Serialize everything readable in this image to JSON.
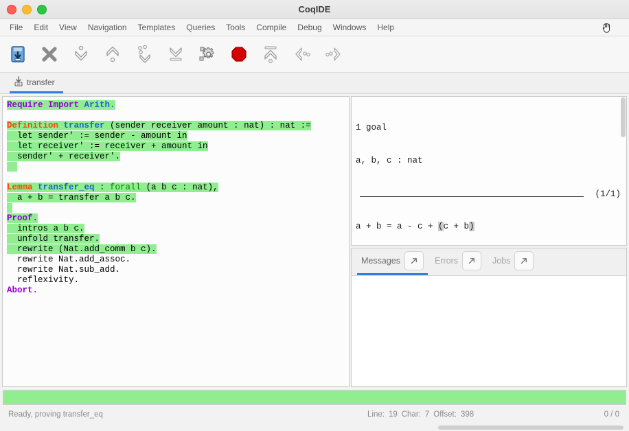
{
  "window": {
    "title": "CoqIDE",
    "controls": [
      "close",
      "minimize",
      "maximize"
    ]
  },
  "menubar": {
    "items": [
      "File",
      "Edit",
      "View",
      "Navigation",
      "Templates",
      "Queries",
      "Tools",
      "Compile",
      "Debug",
      "Windows",
      "Help"
    ],
    "cursor_icon": "open-hand-cursor-icon"
  },
  "toolbar": {
    "buttons": [
      {
        "name": "save-icon",
        "tooltip": "Save"
      },
      {
        "name": "close-x-icon",
        "tooltip": "Close"
      },
      {
        "name": "forward-one-step-icon",
        "tooltip": "Forward one step"
      },
      {
        "name": "backward-one-step-icon",
        "tooltip": "Backward one step"
      },
      {
        "name": "go-to-cursor-icon",
        "tooltip": "Go to cursor"
      },
      {
        "name": "go-to-end-icon",
        "tooltip": "Go to end"
      },
      {
        "name": "compile-gears-icon",
        "tooltip": "Compile"
      },
      {
        "name": "interrupt-stop-icon",
        "tooltip": "Interrupt"
      },
      {
        "name": "restart-icon",
        "tooltip": "Restart"
      },
      {
        "name": "previous-occurrence-icon",
        "tooltip": "Previous"
      },
      {
        "name": "next-occurrence-icon",
        "tooltip": "Next"
      }
    ]
  },
  "file_tabs": [
    {
      "label": "transfer",
      "icon": "file-save-icon",
      "active": true
    }
  ],
  "editor": {
    "lines": [
      {
        "segments": [
          {
            "text": "Require Import ",
            "style": "kw-purple",
            "hl": true
          },
          {
            "text": "Arith.",
            "style": "id-blue",
            "hl": true
          }
        ]
      },
      {
        "segments": []
      },
      {
        "segments": [
          {
            "text": "Definition ",
            "style": "kw-red",
            "hl": true
          },
          {
            "text": "transfer ",
            "style": "id-blue",
            "hl": true
          },
          {
            "text": "(sender receiver amount : nat) : nat :=",
            "style": "plain",
            "hl": true
          }
        ]
      },
      {
        "segments": [
          {
            "text": "  let sender' := sender - amount in",
            "style": "plain",
            "hl": true
          }
        ]
      },
      {
        "segments": [
          {
            "text": "  let receiver' := receiver + amount in",
            "style": "plain",
            "hl": true
          }
        ]
      },
      {
        "segments": [
          {
            "text": "  sender' + receiver'.",
            "style": "plain",
            "hl": true
          }
        ]
      },
      {
        "segments": [
          {
            "text": "  ",
            "style": "plain",
            "hl": true
          }
        ]
      },
      {
        "segments": []
      },
      {
        "segments": [
          {
            "text": "Lemma ",
            "style": "kw-red",
            "hl": true
          },
          {
            "text": "transfer_eq ",
            "style": "id-blue",
            "hl": true
          },
          {
            "text": ": ",
            "style": "plain",
            "hl": true
          },
          {
            "text": "forall ",
            "style": "ty-green",
            "hl": true
          },
          {
            "text": "(a b c : nat),",
            "style": "plain",
            "hl": true
          }
        ]
      },
      {
        "segments": [
          {
            "text": "  a + b = transfer a b c.",
            "style": "plain",
            "hl": true
          }
        ]
      },
      {
        "segments": [
          {
            "text": " ",
            "style": "plain",
            "hl": true
          }
        ]
      },
      {
        "segments": [
          {
            "text": "Proof.",
            "style": "kw-purple",
            "hl": true
          }
        ]
      },
      {
        "segments": [
          {
            "text": "  intros a b c.",
            "style": "plain",
            "hl": true
          }
        ]
      },
      {
        "segments": [
          {
            "text": "  unfold transfer.",
            "style": "plain",
            "hl": true
          }
        ]
      },
      {
        "segments": [
          {
            "text": "  rewrite (Nat.add_comm b c).",
            "style": "plain",
            "hl": true
          }
        ]
      },
      {
        "segments": [
          {
            "text": "  rewrite Nat.add_assoc.",
            "style": "plain",
            "hl": false
          }
        ]
      },
      {
        "segments": [
          {
            "text": "  rewrite Nat.sub_add.",
            "style": "plain",
            "hl": false
          }
        ]
      },
      {
        "segments": [
          {
            "text": "  reflexivity.",
            "style": "plain",
            "hl": false
          }
        ]
      },
      {
        "segments": [
          {
            "text": "Abort.",
            "style": "kw-purple",
            "hl": false
          }
        ]
      }
    ]
  },
  "goal_panel": {
    "goal_count_line": "1 goal",
    "hypotheses_line": "a, b, c : nat",
    "goal_index": "(1/1)",
    "conclusion_prefix": "a + b = a - c + ",
    "conclusion_highlight_open": "(",
    "conclusion_highlight_body": "c + b",
    "conclusion_highlight_close": ")"
  },
  "message_tabs": [
    {
      "label": "Messages",
      "active": true,
      "detach_icon": "detach-arrow-icon"
    },
    {
      "label": "Errors",
      "active": false,
      "detach_icon": "detach-arrow-icon"
    },
    {
      "label": "Jobs",
      "active": false,
      "detach_icon": "detach-arrow-icon"
    }
  ],
  "message_body": "",
  "statusbar": {
    "status": "Ready, proving transfer_eq",
    "line_label": "Line:",
    "line_value": "19",
    "char_label": "Char:",
    "char_value": "7",
    "offset_label": "Offset:",
    "offset_value": "398",
    "right_counter": "0 / 0"
  },
  "colors": {
    "processed_green": "#90ee90",
    "accent_blue": "#2f7ee0",
    "keyword_purple": "#9400d3",
    "keyword_red": "#ff4500",
    "identifier_blue": "#1e64c8",
    "type_green": "#008000"
  }
}
